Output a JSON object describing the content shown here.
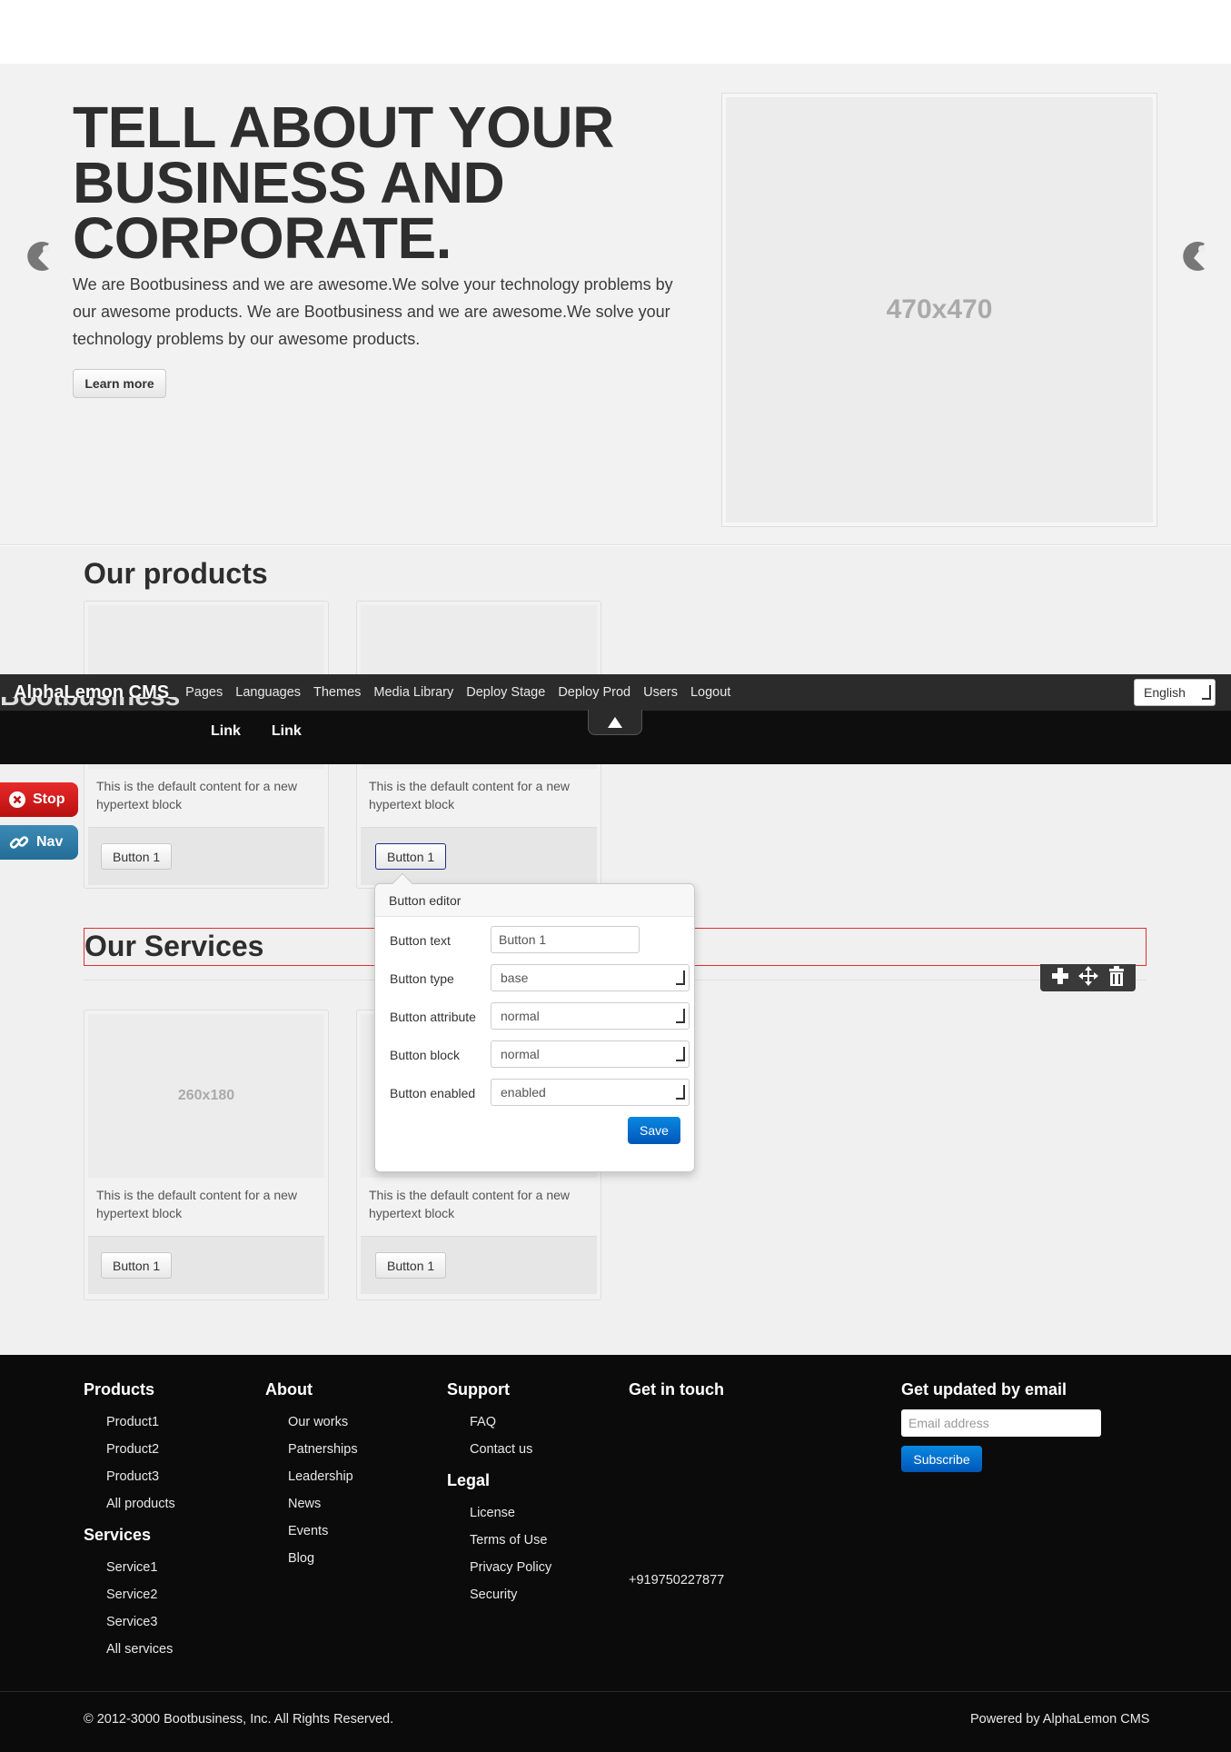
{
  "hero": {
    "title": "TELL ABOUT YOUR BUSINESS AND CORPORATE.",
    "text": "We are Bootbusiness and we are awesome.We solve your technology problems by our awesome products. We are Bootbusiness and we are awesome.We solve your technology problems by our awesome products.",
    "button": "Learn more",
    "image_placeholder": "470x470",
    "prev_icon": "carousel-prev-icon",
    "next_icon": "carousel-next-icon"
  },
  "products": {
    "title": "Our products",
    "cards": [
      {
        "text": "This is the default content for a new hypertext block",
        "button": "Button 1"
      },
      {
        "text": "This is the default content for a new hypertext block",
        "button": "Button 1"
      }
    ]
  },
  "services": {
    "title": "Our Services",
    "cards": [
      {
        "image": "260x180",
        "text": "This is the default content for a new hypertext block",
        "button": "Button 1"
      },
      {
        "image": "",
        "text": "This is the default content for a new hypertext block",
        "button": "Button 1"
      }
    ]
  },
  "admin_bar": {
    "brand": "AlphaLemon CMS",
    "menu": [
      "Pages",
      "Languages",
      "Themes",
      "Media Library",
      "Deploy Stage",
      "Deploy Prod",
      "Users",
      "Logout"
    ],
    "language": "English"
  },
  "site_nav": {
    "brand": "Bootbusiness",
    "links": [
      "Link",
      "Link"
    ]
  },
  "side_buttons": {
    "stop": "Stop",
    "nav": "Nav"
  },
  "block_toolbar": {
    "icons": [
      "add-icon",
      "move-icon",
      "delete-icon"
    ]
  },
  "button_editor": {
    "title": "Button editor",
    "fields": [
      {
        "label": "Button text",
        "value": "Button 1",
        "kind": "input"
      },
      {
        "label": "Button type",
        "value": "base",
        "kind": "select"
      },
      {
        "label": "Button attribute",
        "value": "normal",
        "kind": "select"
      },
      {
        "label": "Button block",
        "value": "normal",
        "kind": "select"
      },
      {
        "label": "Button enabled",
        "value": "enabled",
        "kind": "select"
      }
    ],
    "save": "Save"
  },
  "footer": {
    "products": {
      "title": "Products",
      "items": [
        "Product1",
        "Product2",
        "Product3",
        "All products"
      ]
    },
    "services": {
      "title": "Services",
      "items": [
        "Service1",
        "Service2",
        "Service3",
        "All services"
      ]
    },
    "about": {
      "title": "About",
      "items": [
        "Our works",
        "Patnerships",
        "Leadership",
        "News",
        "Events",
        "Blog"
      ]
    },
    "support": {
      "title": "Support",
      "items": [
        "FAQ",
        "Contact us"
      ]
    },
    "legal": {
      "title": "Legal",
      "items": [
        "License",
        "Terms of Use",
        "Privacy Policy",
        "Security"
      ]
    },
    "contact": {
      "title": "Get in touch",
      "phone": "+919750227877"
    },
    "newsletter": {
      "title": "Get updated by email",
      "placeholder": "Email address",
      "button": "Subscribe"
    },
    "copyright": "© 2012-3000 Bootbusiness, Inc. All Rights Reserved.",
    "powered": "Powered by AlphaLemon CMS"
  },
  "colors": {
    "accent_blue": "#0a6fd0",
    "stop_red": "#d01c1c",
    "nav_blue": "#2f7ca8",
    "admin_bar": "#2b2b2b",
    "footer_bg": "#0b0b0b",
    "selection_outline": "#e03030"
  }
}
